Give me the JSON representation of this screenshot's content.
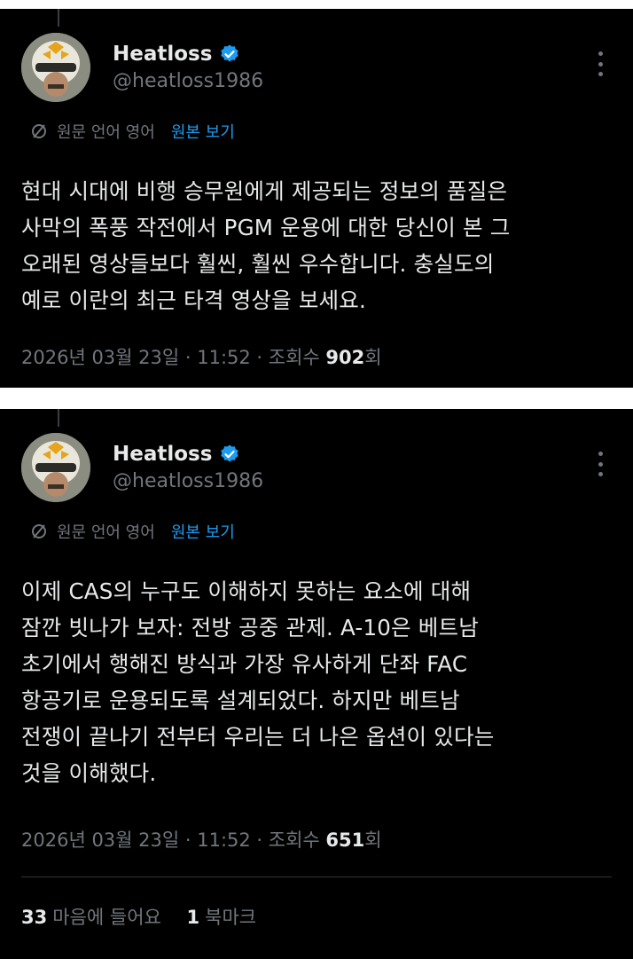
{
  "tweets": [
    {
      "name": "Heatloss",
      "handle": "@heatloss1986",
      "translate_label": "원문 언어 영어",
      "show_original": "원본 보기",
      "lines": [
        "현대 시대에 비행 승무원에게 제공되는 정보의 품질은",
        "사막의 폭풍 작전에서 PGM 운용에 대한 당신이 본 그",
        "오래된 영상들보다 훨씬, 훨씬 우수합니다. 충실도의",
        "예로 이란의 최근 타격 영상을 보세요."
      ],
      "timestamp": "2026년 03월 23일 · 11:52 · 조회수 ",
      "views": "902",
      "views_suffix": "회"
    },
    {
      "name": "Heatloss",
      "handle": "@heatloss1986",
      "translate_label": "원문 언어 영어",
      "show_original": "원본 보기",
      "lines": [
        "이제 CAS의 누구도 이해하지 못하는 요소에 대해",
        "잠깐 빗나가 보자: 전방 공중 관제. A-10은 베트남",
        "초기에서 행해진 방식과 가장 유사하게 단좌 FAC",
        "항공기로 운용되도록 설계되었다. 하지만 베트남",
        "전쟁이 끝나기 전부터 우리는 더 나은 옵션이 있다는",
        "것을 이해했다."
      ],
      "timestamp": "2026년 03월 23일 · 11:52 · 조회수 ",
      "views": "651",
      "views_suffix": "회"
    }
  ],
  "stats": {
    "likes_count": "33",
    "likes_label": "마음에 들어요",
    "bookmarks_count": "1",
    "bookmarks_label": "북마크"
  },
  "colors": {
    "background": "#000000",
    "text": "#e7e9ea",
    "muted": "#71767b",
    "accent": "#1d9bf0"
  },
  "icons": [
    "verified-badge-icon",
    "more-options-icon",
    "translate-icon",
    "avatar"
  ]
}
